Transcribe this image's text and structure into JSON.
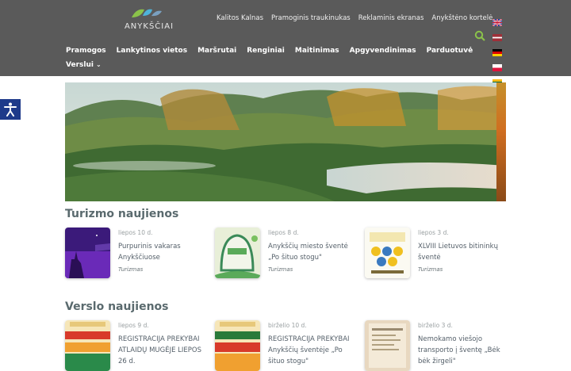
{
  "brand": {
    "name": "ANYKŠČIAI"
  },
  "top_links": [
    "Kalitos Kalnas",
    "Pramoginis traukinukas",
    "Reklaminis ekranas",
    "Anykštėno kortelė"
  ],
  "main_menu": [
    "Pramogos",
    "Lankytinos vietos",
    "Maršrutai",
    "Renginiai",
    "Maitinimas",
    "Apgyvendinimas",
    "Parduotuvė"
  ],
  "sub_menu": {
    "label": "Verslui",
    "chevron": "⌄"
  },
  "icons": {
    "search": "search-icon",
    "accessibility": "accessibility-icon"
  },
  "colors": {
    "header": "#5a5a5a",
    "search": "#8bc34a",
    "accessibility": "#1e3a8a"
  },
  "sections": [
    {
      "heading": "Turizmo naujienos",
      "items": [
        {
          "date": "liepos 10 d.",
          "title": "Purpurinis vakaras Anykščiuose",
          "category": "Turizmas"
        },
        {
          "date": "liepos 8 d.",
          "title": "Anykščių miesto šventė „Po šituo stogu\"",
          "category": "Turizmas"
        },
        {
          "date": "liepos 3 d.",
          "title": "XLVIII Lietuvos bitininkų šventė",
          "category": "Turizmas"
        }
      ]
    },
    {
      "heading": "Verslo naujienos",
      "items": [
        {
          "date": "liepos 9 d.",
          "title": "REGISTRACIJA PREKYBAI ATLAIDŲ MUGĖJE LIEPOS 26 d.",
          "category": ""
        },
        {
          "date": "birželio 10 d.",
          "title": "REGISTRACIJA PREKYBAI Anykščių šventėje „Po šituo stogu\"",
          "category": ""
        },
        {
          "date": "birželio 3 d.",
          "title": "Nemokamo viešojo transporto į šventę „Bėk bėk žirgeli\"",
          "category": ""
        }
      ]
    }
  ]
}
